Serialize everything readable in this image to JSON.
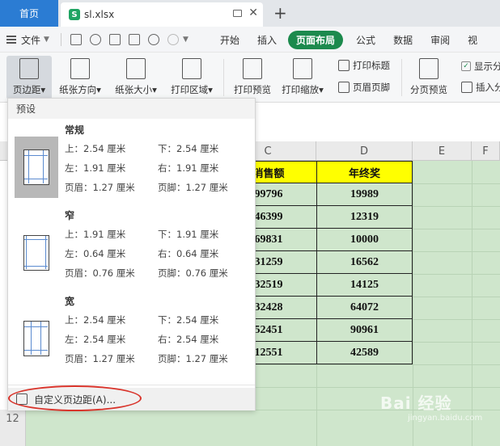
{
  "titlebar": {
    "home_tab": "首页",
    "file_tab": "sl.xlsx",
    "sheet_logo": "S",
    "close_glyph": "✕",
    "new_tab_glyph": "+"
  },
  "menubar": {
    "file_menu": "文件",
    "items": [
      "开始",
      "插入",
      "页面布局",
      "公式",
      "数据",
      "审阅",
      "视"
    ],
    "active_item": "页面布局",
    "active_color": "#1c8a4d"
  },
  "ribbon": {
    "margins": "页边距",
    "orientation": "纸张方向",
    "paper_size": "纸张大小",
    "print_area": "打印区域",
    "print_preview": "打印预览",
    "print_scale": "打印缩放",
    "print_titles": "打印标题",
    "header_footer": "页眉页脚",
    "page_break_preview": "分页预览",
    "show_breaks": "显示分",
    "insert_break": "插入分"
  },
  "spreadsheet": {
    "columns": [
      "C",
      "D",
      "E",
      "F"
    ],
    "row_number": "12",
    "header_row": [
      "消售额",
      "年终奖"
    ],
    "rows": [
      [
        "99796",
        "19989"
      ],
      [
        "46399",
        "12319"
      ],
      [
        "69831",
        "10000"
      ],
      [
        "31259",
        "16562"
      ],
      [
        "32519",
        "14125"
      ],
      [
        "32428",
        "64072"
      ],
      [
        "52451",
        "90961"
      ],
      [
        "12551",
        "42589"
      ]
    ],
    "header_fill": "#ffff00",
    "sheet_fill": "#cfe6cc"
  },
  "margins_dropdown": {
    "section_label": "预设",
    "presets": [
      {
        "name": "常规",
        "top": "上：2.54 厘米",
        "bottom": "下：2.54 厘米",
        "left": "左：1.91 厘米",
        "right": "右：1.91 厘米",
        "header": "页眉：1.27 厘米",
        "footer": "页脚：1.27 厘米"
      },
      {
        "name": "窄",
        "top": "上：1.91 厘米",
        "bottom": "下：1.91 厘米",
        "left": "左：0.64 厘米",
        "right": "右：0.64 厘米",
        "header": "页眉：0.76 厘米",
        "footer": "页脚：0.76 厘米"
      },
      {
        "name": "宽",
        "top": "上：2.54 厘米",
        "bottom": "下：2.54 厘米",
        "left": "左：2.54 厘米",
        "right": "右：2.54 厘米",
        "header": "页眉：1.27 厘米",
        "footer": "页脚：1.27 厘米"
      }
    ],
    "custom_label": "自定义页边距(A)...",
    "highlight_color": "#d9342b"
  },
  "watermark": {
    "logo": "Bai 经验",
    "sub": "jingyan.baidu.com"
  }
}
